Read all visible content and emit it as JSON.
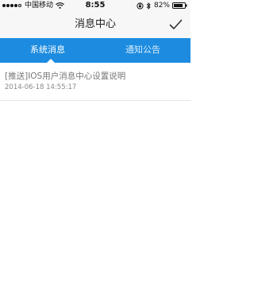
{
  "status_bar": {
    "carrier": "中国移动",
    "time": "8:55",
    "battery": "82%"
  },
  "nav": {
    "title": "消息中心",
    "done_icon": "checkmark-icon"
  },
  "tabs": [
    {
      "label": "系统消息",
      "active": true
    },
    {
      "label": "通知公告",
      "active": false
    }
  ],
  "messages": [
    {
      "title": "[推送]IOS用户消息中心设置说明",
      "time": "2014-06-18 14:55:17"
    }
  ],
  "colors": {
    "accent": "#1d8ce0",
    "nav_bg": "#f7f7f7",
    "text_muted": "#777777"
  }
}
